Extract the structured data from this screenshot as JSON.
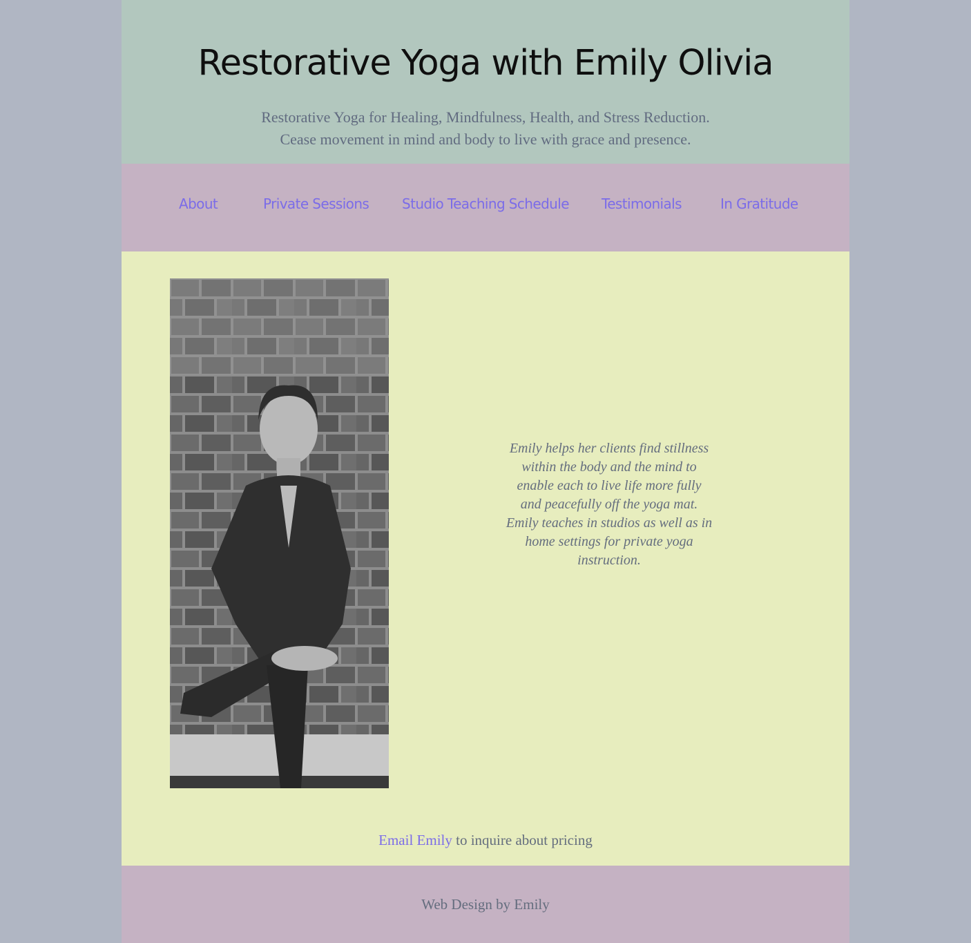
{
  "header": {
    "title": "Restorative Yoga with Emily Olivia",
    "tagline_line1": "Restorative Yoga for Healing, Mindfulness, Health, and Stress Reduction.",
    "tagline_line2": "Cease movement in mind and body to live with grace and presence."
  },
  "nav": {
    "items": [
      {
        "label": "About"
      },
      {
        "label": "Private Sessions"
      },
      {
        "label": "Studio Teaching Schedule"
      },
      {
        "label": "Testimonials"
      },
      {
        "label": "In Gratitude"
      }
    ]
  },
  "main": {
    "photo_alt": "Emily in a standing yoga pose against a brick wall",
    "bio": "Emily helps her clients find stillness within the body and the mind to enable each to live life more fully and peacefully off the yoga mat. Emily teaches in studios as well as in home settings for private yoga instruction.",
    "email_link": "Email Emily",
    "email_suffix": " to inquire about pricing"
  },
  "footer": {
    "credit": "Web Design by Emily"
  },
  "colors": {
    "page_bg": "#b0b6c3",
    "header_bg": "#b2c7be",
    "nav_bg": "#c5b2c3",
    "main_bg": "#e7edbe",
    "link": "#7b6ce8",
    "text": "#646d7e"
  }
}
